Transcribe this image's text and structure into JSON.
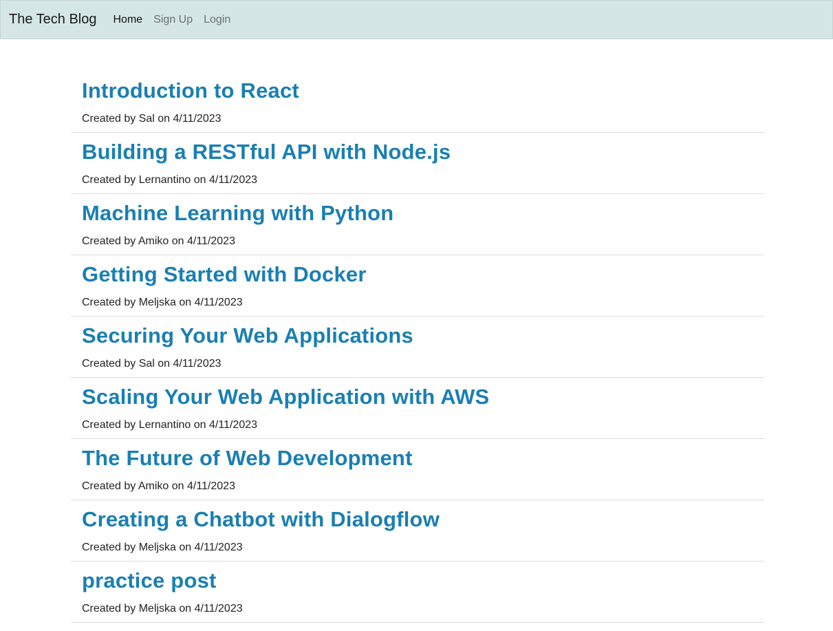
{
  "nav": {
    "brand": "The Tech Blog",
    "links": [
      "Home",
      "Sign Up",
      "Login"
    ]
  },
  "posts": [
    {
      "title": "Introduction to React",
      "meta": "Created by Sal on 4/11/2023"
    },
    {
      "title": "Building a RESTful API with Node.js",
      "meta": "Created by Lernantino on 4/11/2023"
    },
    {
      "title": "Machine Learning with Python",
      "meta": "Created by Amiko on 4/11/2023"
    },
    {
      "title": "Getting Started with Docker",
      "meta": "Created by Meljska on 4/11/2023"
    },
    {
      "title": "Securing Your Web Applications",
      "meta": "Created by Sal on 4/11/2023"
    },
    {
      "title": "Scaling Your Web Application with AWS",
      "meta": "Created by Lernantino on 4/11/2023"
    },
    {
      "title": "The Future of Web Development",
      "meta": "Created by Amiko on 4/11/2023"
    },
    {
      "title": "Creating a Chatbot with Dialogflow",
      "meta": "Created by Meljska on 4/11/2023"
    },
    {
      "title": "practice post",
      "meta": "Created by Meljska on 4/11/2023"
    }
  ],
  "colors": {
    "navbar_bg": "#d4e6e5",
    "title_link": "#1a7fb2"
  }
}
